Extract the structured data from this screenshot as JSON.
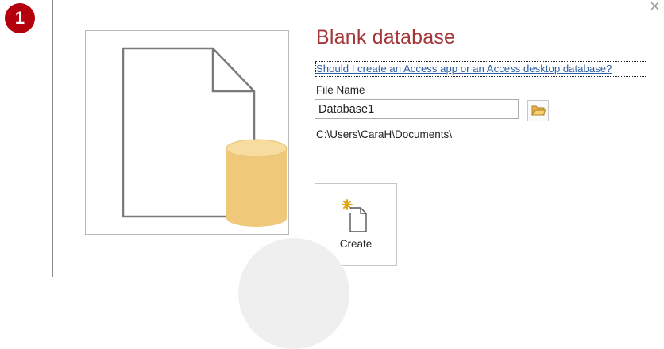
{
  "step_badge": "1",
  "dialog": {
    "title": "Blank database",
    "help_link": "Should I create an Access app or an Access desktop database?",
    "file_name_label": "File Name",
    "file_name_value": "Database1",
    "save_path": "C:\\Users\\CaraH\\Documents\\",
    "create_label": "Create",
    "close_glyph": "×"
  },
  "icons": {
    "preview": "blank-database-document-icon",
    "browse": "folder-icon",
    "create": "new-document-icon",
    "close": "close-icon"
  },
  "colors": {
    "title": "#a4373a",
    "link": "#2e5fa6",
    "badge": "#b3000c",
    "database_cylinder": "#f0c879"
  }
}
